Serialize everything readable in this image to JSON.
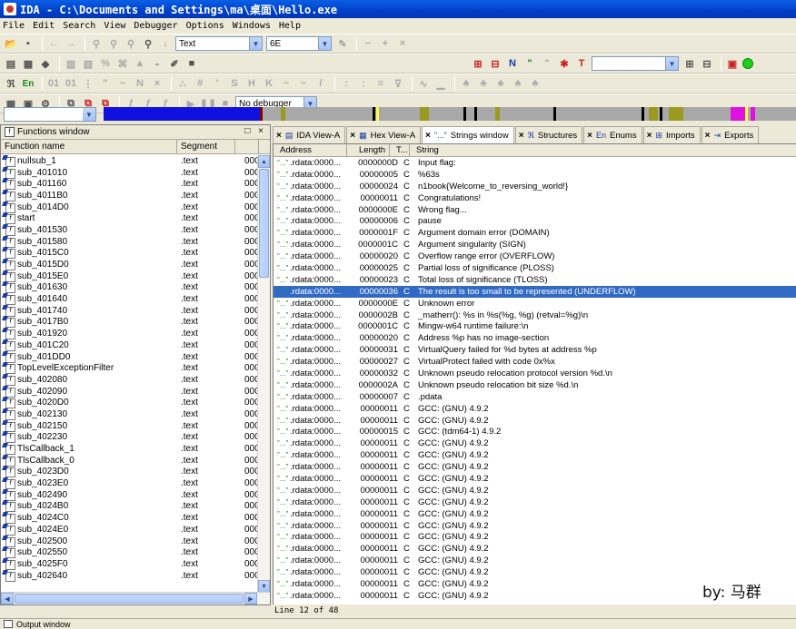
{
  "window": {
    "title": "IDA - C:\\Documents and Settings\\ma\\桌面\\Hello.exe"
  },
  "menu": [
    "File",
    "Edit",
    "Search",
    "View",
    "Debugger",
    "Options",
    "Windows",
    "Help"
  ],
  "toolbar": {
    "search_type": "Text",
    "search_value": "6E",
    "debugger_select": "No debugger"
  },
  "functions_window": {
    "title": "Functions window",
    "close_glyphs": "□ ×",
    "columns": {
      "name": "Function name",
      "segment": "Segment"
    },
    "rows": [
      {
        "name": "nullsub_1",
        "segment": ".text",
        "start": "000"
      },
      {
        "name": "sub_401010",
        "segment": ".text",
        "start": "000"
      },
      {
        "name": "sub_401160",
        "segment": ".text",
        "start": "000"
      },
      {
        "name": "sub_4011B0",
        "segment": ".text",
        "start": "000"
      },
      {
        "name": "sub_4014D0",
        "segment": ".text",
        "start": "000"
      },
      {
        "name": "start",
        "segment": ".text",
        "start": "000"
      },
      {
        "name": "sub_401530",
        "segment": ".text",
        "start": "000"
      },
      {
        "name": "sub_401580",
        "segment": ".text",
        "start": "000"
      },
      {
        "name": "sub_4015C0",
        "segment": ".text",
        "start": "000"
      },
      {
        "name": "sub_4015D0",
        "segment": ".text",
        "start": "000"
      },
      {
        "name": "sub_4015E0",
        "segment": ".text",
        "start": "000"
      },
      {
        "name": "sub_401630",
        "segment": ".text",
        "start": "000"
      },
      {
        "name": "sub_401640",
        "segment": ".text",
        "start": "000"
      },
      {
        "name": "sub_401740",
        "segment": ".text",
        "start": "000"
      },
      {
        "name": "sub_4017B0",
        "segment": ".text",
        "start": "000"
      },
      {
        "name": "sub_401920",
        "segment": ".text",
        "start": "000"
      },
      {
        "name": "sub_401C20",
        "segment": ".text",
        "start": "000"
      },
      {
        "name": "sub_401DD0",
        "segment": ".text",
        "start": "000"
      },
      {
        "name": "TopLevelExceptionFilter",
        "segment": ".text",
        "start": "000"
      },
      {
        "name": "sub_402080",
        "segment": ".text",
        "start": "000"
      },
      {
        "name": "sub_402090",
        "segment": ".text",
        "start": "000"
      },
      {
        "name": "sub_4020D0",
        "segment": ".text",
        "start": "000"
      },
      {
        "name": "sub_402130",
        "segment": ".text",
        "start": "000"
      },
      {
        "name": "sub_402150",
        "segment": ".text",
        "start": "000"
      },
      {
        "name": "sub_402230",
        "segment": ".text",
        "start": "000"
      },
      {
        "name": "TlsCallback_1",
        "segment": ".text",
        "start": "000"
      },
      {
        "name": "TlsCallback_0",
        "segment": ".text",
        "start": "000"
      },
      {
        "name": "sub_4023D0",
        "segment": ".text",
        "start": "000"
      },
      {
        "name": "sub_4023E0",
        "segment": ".text",
        "start": "000"
      },
      {
        "name": "sub_402490",
        "segment": ".text",
        "start": "000"
      },
      {
        "name": "sub_4024B0",
        "segment": ".text",
        "start": "000"
      },
      {
        "name": "sub_4024C0",
        "segment": ".text",
        "start": "000"
      },
      {
        "name": "sub_4024E0",
        "segment": ".text",
        "start": "000"
      },
      {
        "name": "sub_402500",
        "segment": ".text",
        "start": "000"
      },
      {
        "name": "sub_402550",
        "segment": ".text",
        "start": "000"
      },
      {
        "name": "sub_4025F0",
        "segment": ".text",
        "start": "000"
      },
      {
        "name": "sub_402640",
        "segment": ".text",
        "start": "000"
      }
    ]
  },
  "tabs": [
    {
      "label": "IDA View-A",
      "icon": "▤"
    },
    {
      "label": "Hex View-A",
      "icon": "▦"
    },
    {
      "label": "Strings window",
      "icon": "\"...\"",
      "active": true
    },
    {
      "label": "Structures",
      "icon": "ℜ"
    },
    {
      "label": "Enums",
      "icon": "En"
    },
    {
      "label": "Imports",
      "icon": "⊞"
    },
    {
      "label": "Exports",
      "icon": "⇥"
    }
  ],
  "strings_window": {
    "columns": {
      "address": "Address",
      "length": "Length",
      "type": "T...",
      "string": "String"
    },
    "selected_index": 11,
    "rows": [
      {
        "addr": ".rdata:0000...",
        "len": "0000000D",
        "t": "C",
        "s": "Input flag:"
      },
      {
        "addr": ".rdata:0000...",
        "len": "00000005",
        "t": "C",
        "s": "%63s"
      },
      {
        "addr": ".rdata:0000...",
        "len": "00000024",
        "t": "C",
        "s": "n1book{Welcome_to_reversing_world!}"
      },
      {
        "addr": ".rdata:0000...",
        "len": "00000011",
        "t": "C",
        "s": "Congratulations!"
      },
      {
        "addr": ".rdata:0000...",
        "len": "0000000E",
        "t": "C",
        "s": "Wrong flag..."
      },
      {
        "addr": ".rdata:0000...",
        "len": "00000006",
        "t": "C",
        "s": "pause"
      },
      {
        "addr": ".rdata:0000...",
        "len": "0000001F",
        "t": "C",
        "s": "Argument domain error (DOMAIN)"
      },
      {
        "addr": ".rdata:0000...",
        "len": "0000001C",
        "t": "C",
        "s": "Argument singularity (SIGN)"
      },
      {
        "addr": ".rdata:0000...",
        "len": "00000020",
        "t": "C",
        "s": "Overflow range error (OVERFLOW)"
      },
      {
        "addr": ".rdata:0000...",
        "len": "00000025",
        "t": "C",
        "s": "Partial loss of significance (PLOSS)"
      },
      {
        "addr": ".rdata:0000...",
        "len": "00000023",
        "t": "C",
        "s": "Total loss of significance (TLOSS)"
      },
      {
        "addr": ".rdata:0000...",
        "len": "00000036",
        "t": "C",
        "s": "The result is too small to be represented (UNDERFLOW)"
      },
      {
        "addr": ".rdata:0000...",
        "len": "0000000E",
        "t": "C",
        "s": "Unknown error"
      },
      {
        "addr": ".rdata:0000...",
        "len": "0000002B",
        "t": "C",
        "s": "_matherr(): %s in %s(%g, %g)  (retval=%g)\\n"
      },
      {
        "addr": ".rdata:0000...",
        "len": "0000001C",
        "t": "C",
        "s": "Mingw-w64 runtime failure:\\n"
      },
      {
        "addr": ".rdata:0000...",
        "len": "00000020",
        "t": "C",
        "s": "Address %p has no image-section"
      },
      {
        "addr": ".rdata:0000...",
        "len": "00000031",
        "t": "C",
        "s": "  VirtualQuery failed for %d bytes at address %p"
      },
      {
        "addr": ".rdata:0000...",
        "len": "00000027",
        "t": "C",
        "s": "  VirtualProtect failed with code 0x%x"
      },
      {
        "addr": ".rdata:0000...",
        "len": "00000032",
        "t": "C",
        "s": "  Unknown pseudo relocation protocol version %d.\\n"
      },
      {
        "addr": ".rdata:0000...",
        "len": "0000002A",
        "t": "C",
        "s": "  Unknown pseudo relocation bit size %d.\\n"
      },
      {
        "addr": ".rdata:0000...",
        "len": "00000007",
        "t": "C",
        "s": ".pdata"
      },
      {
        "addr": ".rdata:0000...",
        "len": "00000011",
        "t": "C",
        "s": "GCC: (GNU) 4.9.2"
      },
      {
        "addr": ".rdata:0000...",
        "len": "00000011",
        "t": "C",
        "s": "GCC: (GNU) 4.9.2"
      },
      {
        "addr": ".rdata:0000...",
        "len": "00000015",
        "t": "C",
        "s": "GCC: (tdm64-1) 4.9.2"
      },
      {
        "addr": ".rdata:0000...",
        "len": "00000011",
        "t": "C",
        "s": "GCC: (GNU) 4.9.2"
      },
      {
        "addr": ".rdata:0000...",
        "len": "00000011",
        "t": "C",
        "s": "GCC: (GNU) 4.9.2"
      },
      {
        "addr": ".rdata:0000...",
        "len": "00000011",
        "t": "C",
        "s": "GCC: (GNU) 4.9.2"
      },
      {
        "addr": ".rdata:0000...",
        "len": "00000011",
        "t": "C",
        "s": "GCC: (GNU) 4.9.2"
      },
      {
        "addr": ".rdata:0000...",
        "len": "00000011",
        "t": "C",
        "s": "GCC: (GNU) 4.9.2"
      },
      {
        "addr": ".rdata:0000...",
        "len": "00000011",
        "t": "C",
        "s": "GCC: (GNU) 4.9.2"
      },
      {
        "addr": ".rdata:0000...",
        "len": "00000011",
        "t": "C",
        "s": "GCC: (GNU) 4.9.2"
      },
      {
        "addr": ".rdata:0000...",
        "len": "00000011",
        "t": "C",
        "s": "GCC: (GNU) 4.9.2"
      },
      {
        "addr": ".rdata:0000...",
        "len": "00000011",
        "t": "C",
        "s": "GCC: (GNU) 4.9.2"
      },
      {
        "addr": ".rdata:0000...",
        "len": "00000011",
        "t": "C",
        "s": "GCC: (GNU) 4.9.2"
      },
      {
        "addr": ".rdata:0000...",
        "len": "00000011",
        "t": "C",
        "s": "GCC: (GNU) 4.9.2"
      },
      {
        "addr": ".rdata:0000...",
        "len": "00000011",
        "t": "C",
        "s": "GCC: (GNU) 4.9.2"
      },
      {
        "addr": ".rdata:0000...",
        "len": "00000011",
        "t": "C",
        "s": "GCC: (GNU) 4.9.2"
      },
      {
        "addr": ".rdata:0000...",
        "len": "00000011",
        "t": "C",
        "s": "GCC: (GNU) 4.9.2"
      }
    ],
    "status": "Line 12 of 48"
  },
  "watermark": "by: 马群",
  "output_window": {
    "title": "Output window"
  },
  "colors": {
    "selection": "#316ac5",
    "titlebar": "#0040c8",
    "nav_code": "#1010e0",
    "nav_data": "#9a9a20",
    "nav_import": "#e010e0"
  }
}
